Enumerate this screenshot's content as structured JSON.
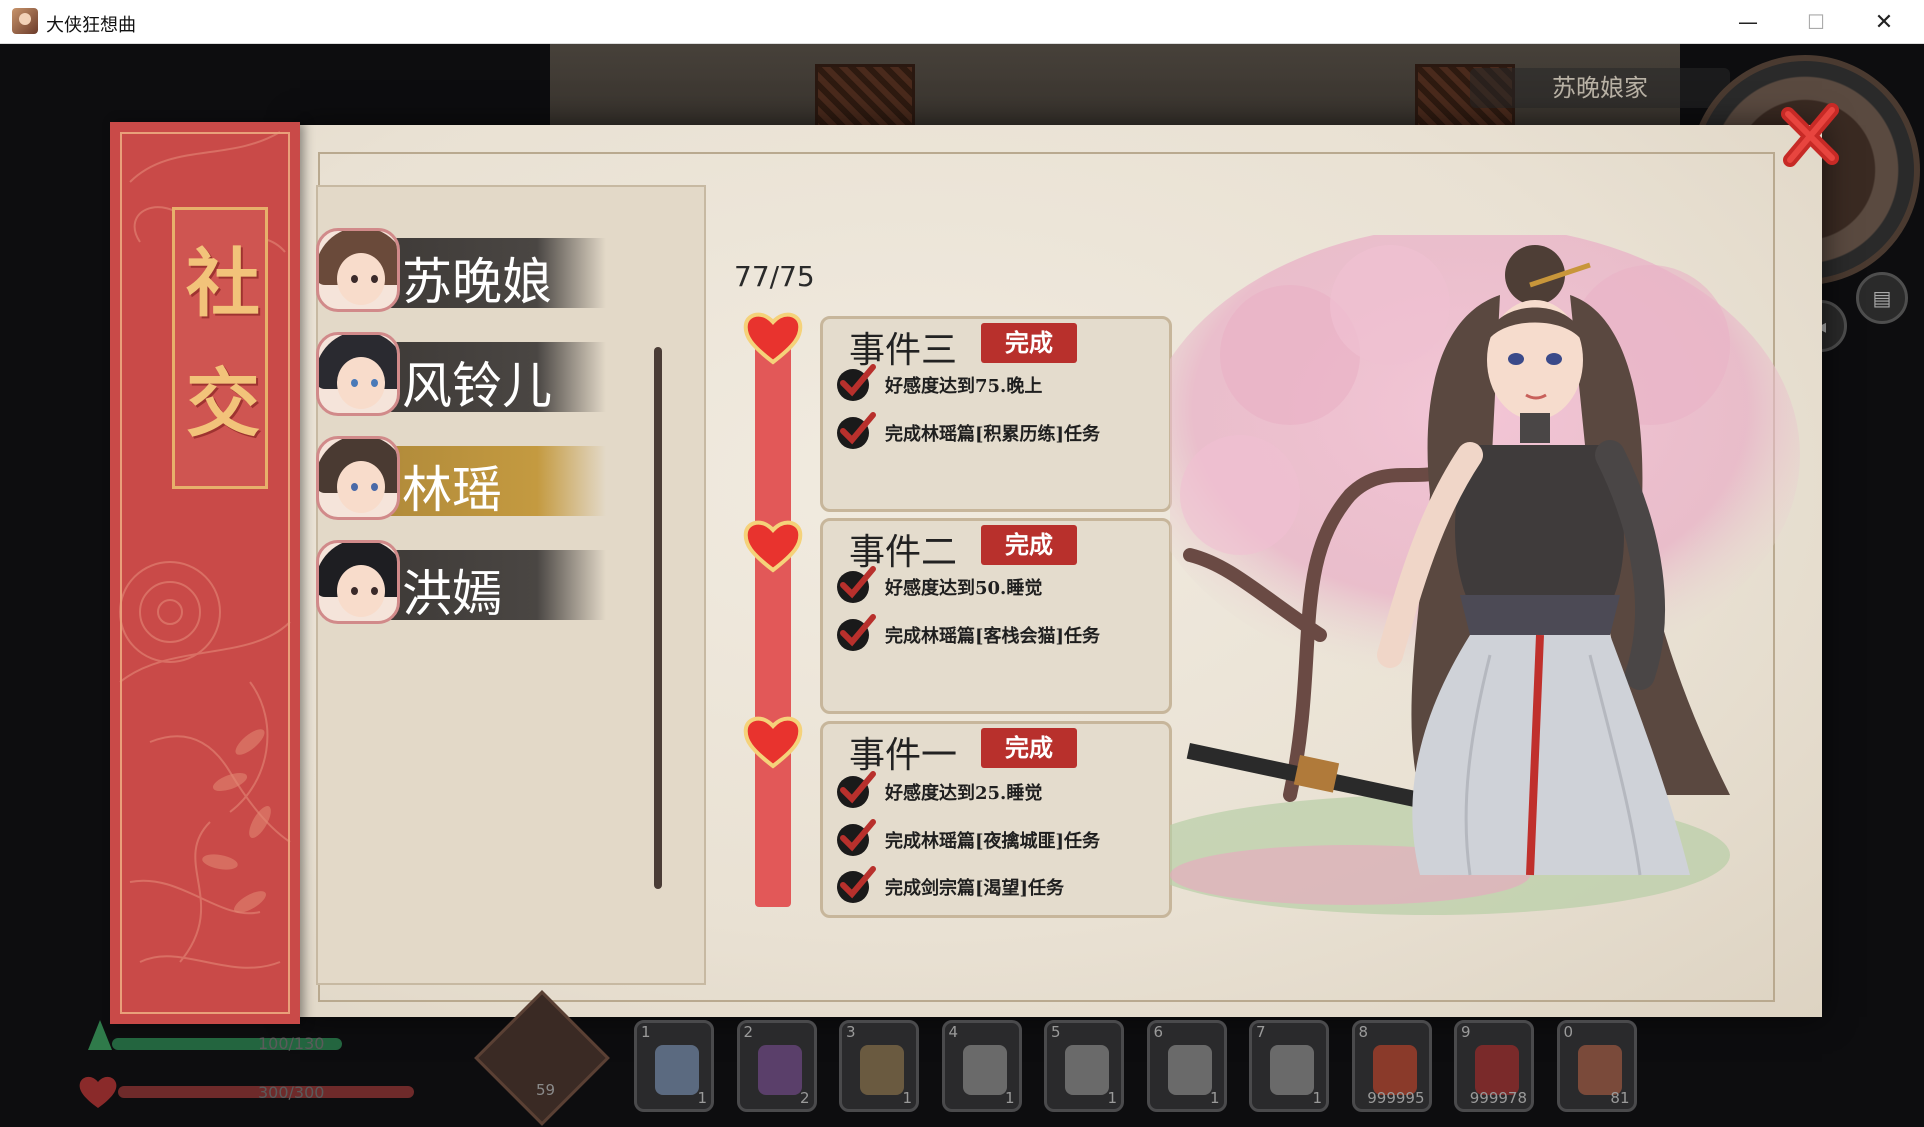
{
  "window": {
    "title": "大侠狂想曲",
    "minimize": "—",
    "maximize": "☐",
    "close": "✕"
  },
  "location": "苏晚娘家",
  "panel": {
    "title": "社交",
    "characters": [
      {
        "name": "苏晚娘",
        "selected": false
      },
      {
        "name": "风铃儿",
        "selected": false
      },
      {
        "name": "林瑶",
        "selected": true
      },
      {
        "name": "洪嫣",
        "selected": false
      }
    ],
    "affection_progress": "77/75",
    "events": [
      {
        "title": "事件三",
        "status": "完成",
        "conditions": [
          "好感度达到75.晚上",
          "完成林瑶篇[积累历练]任务"
        ]
      },
      {
        "title": "事件二",
        "status": "完成",
        "conditions": [
          "好感度达到50.睡觉",
          "完成林瑶篇[客栈会猫]任务"
        ]
      },
      {
        "title": "事件一",
        "status": "完成",
        "conditions": [
          "好感度达到25.睡觉",
          "完成林瑶篇[夜擒城匪]任务",
          "完成剑宗篇[渴望]任务"
        ]
      }
    ]
  },
  "hud": {
    "stamina": "100/130",
    "health": "300/300",
    "skill_count": "59",
    "slots": [
      {
        "num": "1",
        "qty": "1",
        "icon": "fish-icon",
        "color": "#5b6a80"
      },
      {
        "num": "2",
        "qty": "2",
        "icon": "fishing-rod-icon",
        "color": "#5a3f6a"
      },
      {
        "num": "3",
        "qty": "1",
        "icon": "bucket-icon",
        "color": "#6a5a40"
      },
      {
        "num": "4",
        "qty": "1",
        "icon": "axe-icon",
        "color": "#6a6a6a"
      },
      {
        "num": "5",
        "qty": "1",
        "icon": "hatchet-icon",
        "color": "#6a6a6a"
      },
      {
        "num": "6",
        "qty": "1",
        "icon": "pickaxe-icon",
        "color": "#6a6a6a"
      },
      {
        "num": "7",
        "qty": "1",
        "icon": "sickle-icon",
        "color": "#6a6a6a"
      },
      {
        "num": "8",
        "qty": "999995",
        "icon": "food-bowl-icon",
        "color": "#8a3a2a"
      },
      {
        "num": "9",
        "qty": "999978",
        "icon": "berries-icon",
        "color": "#7a2a2a"
      },
      {
        "num": "0",
        "qty": "81",
        "icon": "pepper-pouch-icon",
        "color": "#7a4a3a"
      }
    ]
  }
}
